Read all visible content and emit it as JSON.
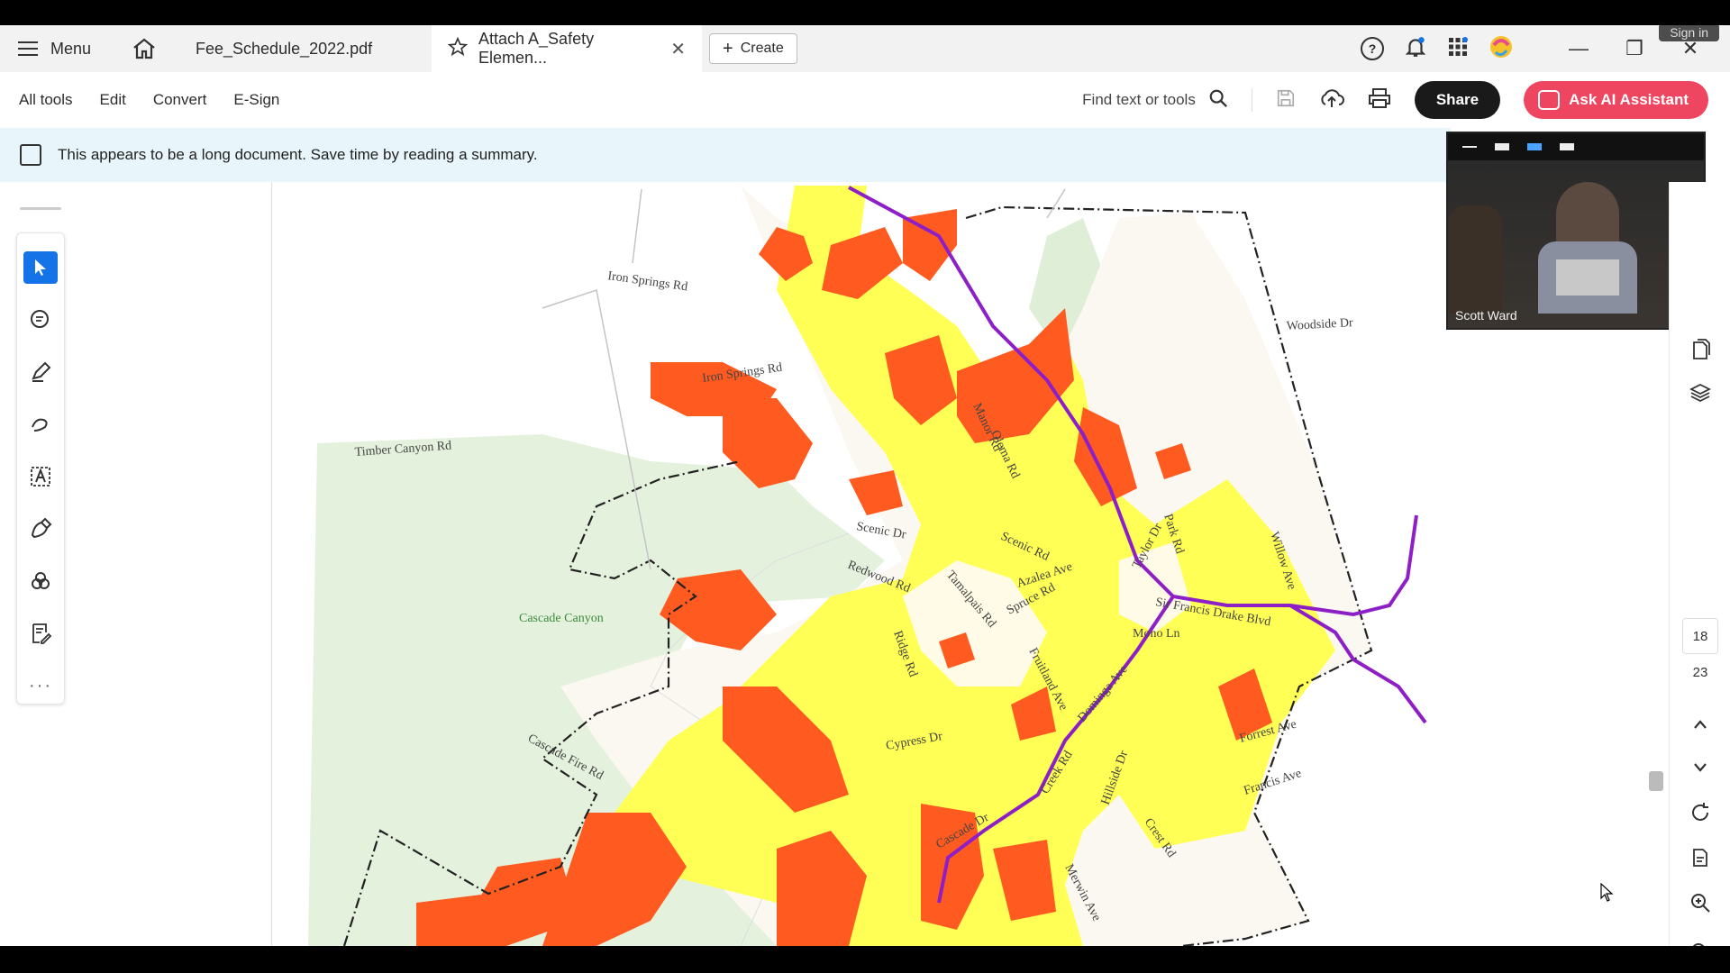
{
  "window": {
    "sign_in": "Sign in"
  },
  "tabbar": {
    "menu_label": "Menu",
    "tabs": [
      {
        "label": "Fee_Schedule_2022.pdf"
      },
      {
        "label": "Attach A_Safety Elemen..."
      }
    ],
    "create_label": "Create"
  },
  "toolbar": {
    "items": [
      "All tools",
      "Edit",
      "Convert",
      "E-Sign"
    ],
    "find_label": "Find text or tools",
    "share_label": "Share",
    "ai_label": "Ask AI Assistant"
  },
  "banner": {
    "text": "This appears to be a long document. Save time by reading a summary."
  },
  "video": {
    "participant": "Scott Ward"
  },
  "pagination": {
    "current": "18",
    "total": "23"
  },
  "map_labels": {
    "iron_springs_1": "Iron Springs Rd",
    "iron_springs_2": "Iron Springs Rd",
    "timber_canyon": "Timber Canyon Rd",
    "woodside": "Woodside Dr",
    "cascade_canyon": "Cascade Canyon",
    "cascade_fire": "Cascade Fire Rd",
    "scenic_dr": "Scenic Dr",
    "scenic_rd": "Scenic Rd",
    "redwood": "Redwood Rd",
    "tamalpais": "Tamalpais Rd",
    "azalea": "Azalea Ave",
    "spruce": "Spruce Rd",
    "mono": "Mono Ln",
    "bolinas": "Sir Francis Drake Blvd",
    "forrest": "Forrest Ave",
    "francis": "Francis Ave",
    "creek": "Creek Rd",
    "crest": "Crest Rd",
    "hillside": "Hillside Dr",
    "cypress": "Cypress Dr",
    "cascade_dr": "Cascade Dr",
    "merwin": "Merwin Ave",
    "taylor": "Taylor Dr",
    "willow": "Willow Ave",
    "manor": "Manor Rd",
    "olema": "Olema Rd",
    "fruitland": "Fruitland Ave",
    "ridge": "Ridge Rd",
    "dominga": "Dominga Ave",
    "park": "Park Rd"
  },
  "colors": {
    "high_hazard": "#ff5a1f",
    "moderate_hazard": "#ffff55",
    "route": "#8e1fc7",
    "open_space": "#e4f1dc",
    "accent": "#1473e6",
    "ai_button": "#ee4560"
  }
}
